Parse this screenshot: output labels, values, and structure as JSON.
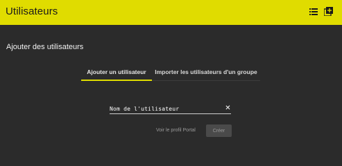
{
  "header": {
    "title": "Utilisateurs",
    "background": "#e0dc00",
    "icons": [
      "list-icon",
      "add-box-icon"
    ]
  },
  "main": {
    "section_title": "Ajouter des utilisateurs",
    "tabs": [
      {
        "label": "Ajouter un utilisateur",
        "active": true
      },
      {
        "label": "Importer les utilisateurs d'un groupe",
        "active": false
      }
    ],
    "username_field": {
      "placeholder": "Nom de l'utilisateur",
      "value": ""
    },
    "portal_link": "Voir le profil Portal",
    "create_button": "Créer"
  },
  "colors": {
    "background": "#2b2b2b",
    "accent": "#e0dc00"
  }
}
